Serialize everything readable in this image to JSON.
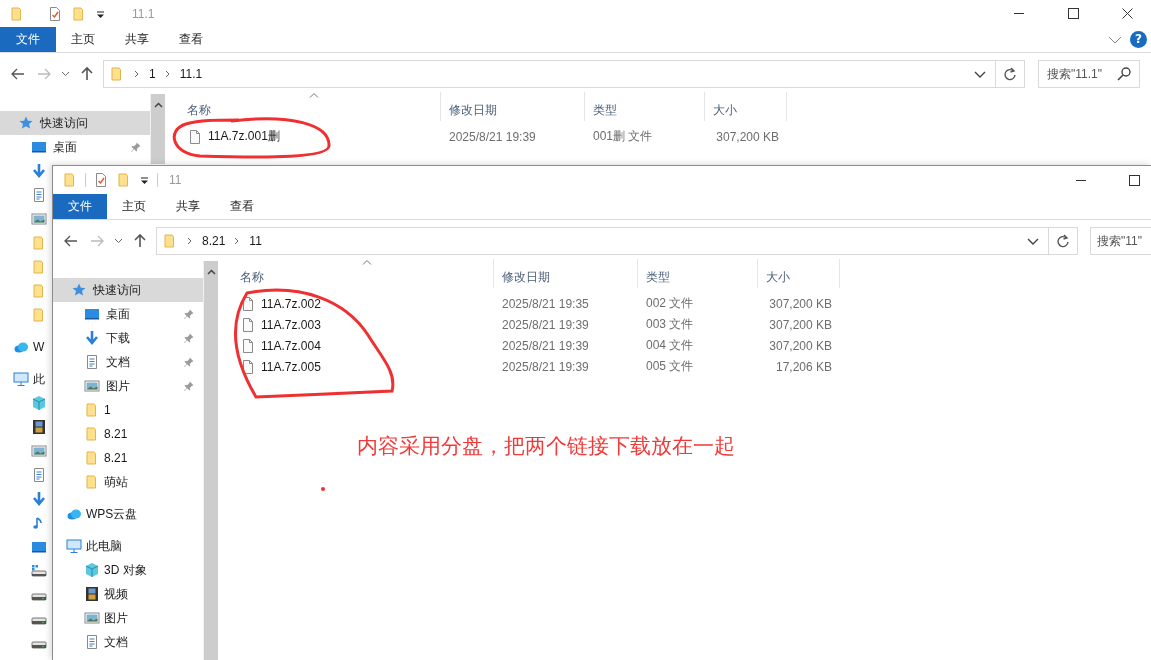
{
  "back_window": {
    "title": "11.1",
    "ribbon": {
      "tabs": [
        {
          "label": "文件",
          "kind": "file"
        },
        {
          "label": "主页",
          "kind": "tab"
        },
        {
          "label": "共享",
          "kind": "tab"
        },
        {
          "label": "查看",
          "kind": "tab"
        }
      ],
      "help": "?"
    },
    "path": [
      "1",
      "11.1"
    ],
    "search": {
      "placeholder": "搜索\"11.1\""
    },
    "sidebar": {
      "items": [
        {
          "label": "快速访问",
          "kind": "star",
          "selected": true,
          "children": [
            {
              "label": "桌面",
              "kind": "desktop",
              "pinned": true,
              "selected": false
            },
            {
              "kind": "download",
              "selected": false
            },
            {
              "kind": "document",
              "selected": false
            },
            {
              "kind": "picture",
              "selected": false
            },
            {
              "kind": "folder",
              "selected": false
            },
            {
              "kind": "folder",
              "selected": false
            },
            {
              "kind": "folder",
              "selected": false
            },
            {
              "kind": "folder",
              "selected": false
            }
          ]
        },
        {
          "label": "W",
          "kind": "cloud",
          "selected": false
        },
        {
          "label": "此",
          "kind": "pc",
          "selected": false,
          "children": [
            {
              "kind": "cube",
              "selected": false
            },
            {
              "kind": "video",
              "selected": false
            },
            {
              "kind": "picture",
              "selected": false
            },
            {
              "kind": "document",
              "selected": false
            },
            {
              "kind": "download",
              "selected": false
            },
            {
              "kind": "music",
              "selected": false
            },
            {
              "kind": "desktop",
              "selected": false
            },
            {
              "kind": "netdrive",
              "selected": false
            },
            {
              "kind": "drive",
              "selected": false
            },
            {
              "kind": "drive",
              "selected": false
            },
            {
              "kind": "drive",
              "selected": false
            }
          ]
        }
      ]
    },
    "table": {
      "columns": [
        {
          "label": "名称",
          "sorted": true
        },
        {
          "label": "修改日期",
          "sorted": false
        },
        {
          "label": "类型",
          "sorted": false
        },
        {
          "label": "大小",
          "sorted": false
        }
      ],
      "rows": [
        [
          "11A.7z.001删",
          "2025/8/21 19:39",
          "001删 文件",
          "307,200 KB"
        ]
      ]
    }
  },
  "front_window": {
    "title": "11",
    "ribbon": {
      "tabs": [
        {
          "label": "文件",
          "kind": "file"
        },
        {
          "label": "主页",
          "kind": "tab"
        },
        {
          "label": "共享",
          "kind": "tab"
        },
        {
          "label": "查看",
          "kind": "tab"
        }
      ]
    },
    "path": [
      "8.21",
      "11"
    ],
    "search": {
      "placeholder": "搜索\"11\""
    },
    "sidebar": {
      "items": [
        {
          "label": "快速访问",
          "kind": "star",
          "selected": true,
          "children": [
            {
              "label": "桌面",
              "kind": "desktop",
              "pinned": true,
              "selected": false
            },
            {
              "label": "下载",
              "kind": "download",
              "pinned": true,
              "selected": false
            },
            {
              "label": "文档",
              "kind": "document",
              "pinned": true,
              "selected": false
            },
            {
              "label": "图片",
              "kind": "picture",
              "pinned": true,
              "selected": false
            },
            {
              "label": "1",
              "kind": "folder",
              "pinned": false,
              "selected": false
            },
            {
              "label": "8.21",
              "kind": "folder",
              "pinned": false,
              "selected": false
            },
            {
              "label": "8.21",
              "kind": "folder",
              "pinned": false,
              "selected": false
            },
            {
              "label": "萌站",
              "kind": "folder",
              "pinned": false,
              "selected": false
            }
          ]
        },
        {
          "label": "WPS云盘",
          "kind": "cloud",
          "selected": false
        },
        {
          "label": "此电脑",
          "kind": "pc",
          "selected": false,
          "children": [
            {
              "label": "3D 对象",
              "kind": "cube",
              "selected": false
            },
            {
              "label": "视频",
              "kind": "video",
              "selected": false
            },
            {
              "label": "图片",
              "kind": "picture",
              "selected": false
            },
            {
              "label": "文档",
              "kind": "document",
              "selected": false
            }
          ]
        }
      ]
    },
    "table": {
      "columns": [
        {
          "label": "名称",
          "sorted": true
        },
        {
          "label": "修改日期",
          "sorted": false
        },
        {
          "label": "类型",
          "sorted": false
        },
        {
          "label": "大小",
          "sorted": false
        }
      ],
      "rows": [
        [
          "11A.7z.002",
          "2025/8/21 19:35",
          "002 文件",
          "307,200 KB"
        ],
        [
          "11A.7z.003",
          "2025/8/21 19:39",
          "003 文件",
          "307,200 KB"
        ],
        [
          "11A.7z.004",
          "2025/8/21 19:39",
          "004 文件",
          "307,200 KB"
        ],
        [
          "11A.7z.005",
          "2025/8/21 19:39",
          "005 文件",
          "17,206 KB"
        ]
      ]
    }
  },
  "annotation": {
    "note": "内容采用分盘，把两个链接下载放在一起"
  }
}
